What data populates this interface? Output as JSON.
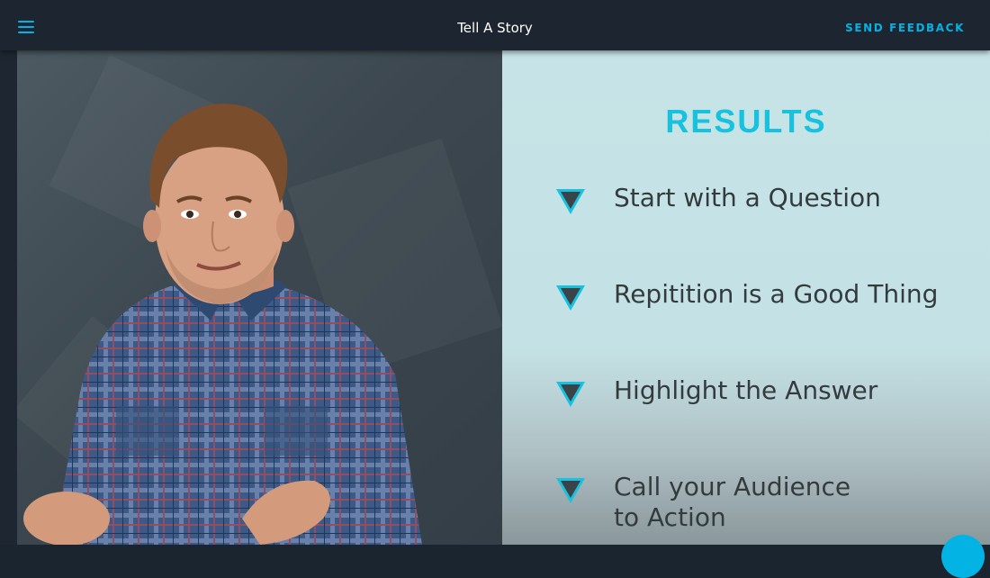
{
  "header": {
    "title": "Tell A Story",
    "feedback_label": "SEND FEEDBACK",
    "menu_icon": "hamburger-menu-icon"
  },
  "slide": {
    "heading": "RESULTS",
    "accent_color": "#18c1dd",
    "bullets": [
      {
        "text": "Start with a Question"
      },
      {
        "text": "Repitition is a Good Thing"
      },
      {
        "text": "Highlight the Answer"
      },
      {
        "text": "Call your Audience\nto Action"
      }
    ]
  },
  "colors": {
    "topbar": "#1c2530",
    "brand_blue": "#02b3e4"
  }
}
